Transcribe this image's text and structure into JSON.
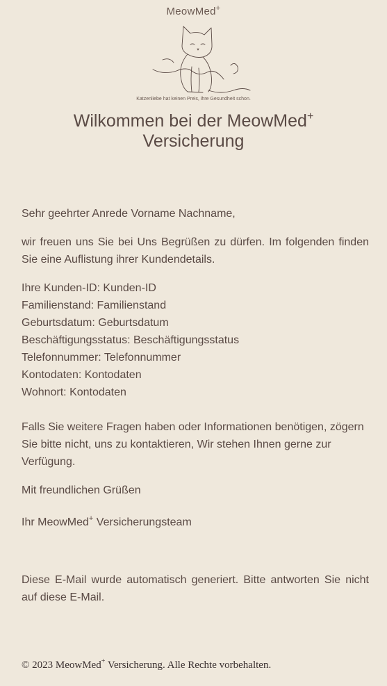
{
  "logo": {
    "brand": "MeowMed",
    "brand_sup": "+",
    "tagline": "Katzenliebe hat keinen Preis, ihre Gesundheit schon."
  },
  "header": {
    "title_part1": "Wilkommen bei der MeowMed",
    "title_sup": "+",
    "title_part2": "Versicherung"
  },
  "email": {
    "greeting": "Sehr geehrter Anrede Vorname Nachname,",
    "intro": "wir freuen uns Sie bei Uns Begrüßen zu dürfen. Im folgenden finden Sie eine Auflistung ihrer Kundendetails.",
    "details": [
      "Ihre Kunden-ID: Kunden-ID",
      "Familienstand: Familienstand",
      "Geburtsdatum: Geburtsdatum",
      "Beschäftigungsstatus: Beschäftigungsstatus",
      "Telefonnummer: Telefonnummer",
      "Kontodaten: Kontodaten",
      "Wohnort: Kontodaten"
    ],
    "questions": "Falls Sie weitere Fragen haben oder Informationen benötigen, zögern Sie bitte nicht, uns zu kontaktieren, Wir stehen Ihnen gerne zur Verfügung.",
    "closing": "Mit freundlichen Grüßen",
    "signature_part1": "Ihr MeowMed",
    "signature_sup": "+",
    "signature_part2": " Versicherungsteam",
    "auto_notice": "Diese E-Mail wurde automatisch generiert. Bitte antworten Sie nicht auf diese E-Mail."
  },
  "footer": {
    "part1": "© 2023 MeowMed",
    "sup": "+",
    "part2": " Versicherung. Alle Rechte vorbehalten."
  }
}
